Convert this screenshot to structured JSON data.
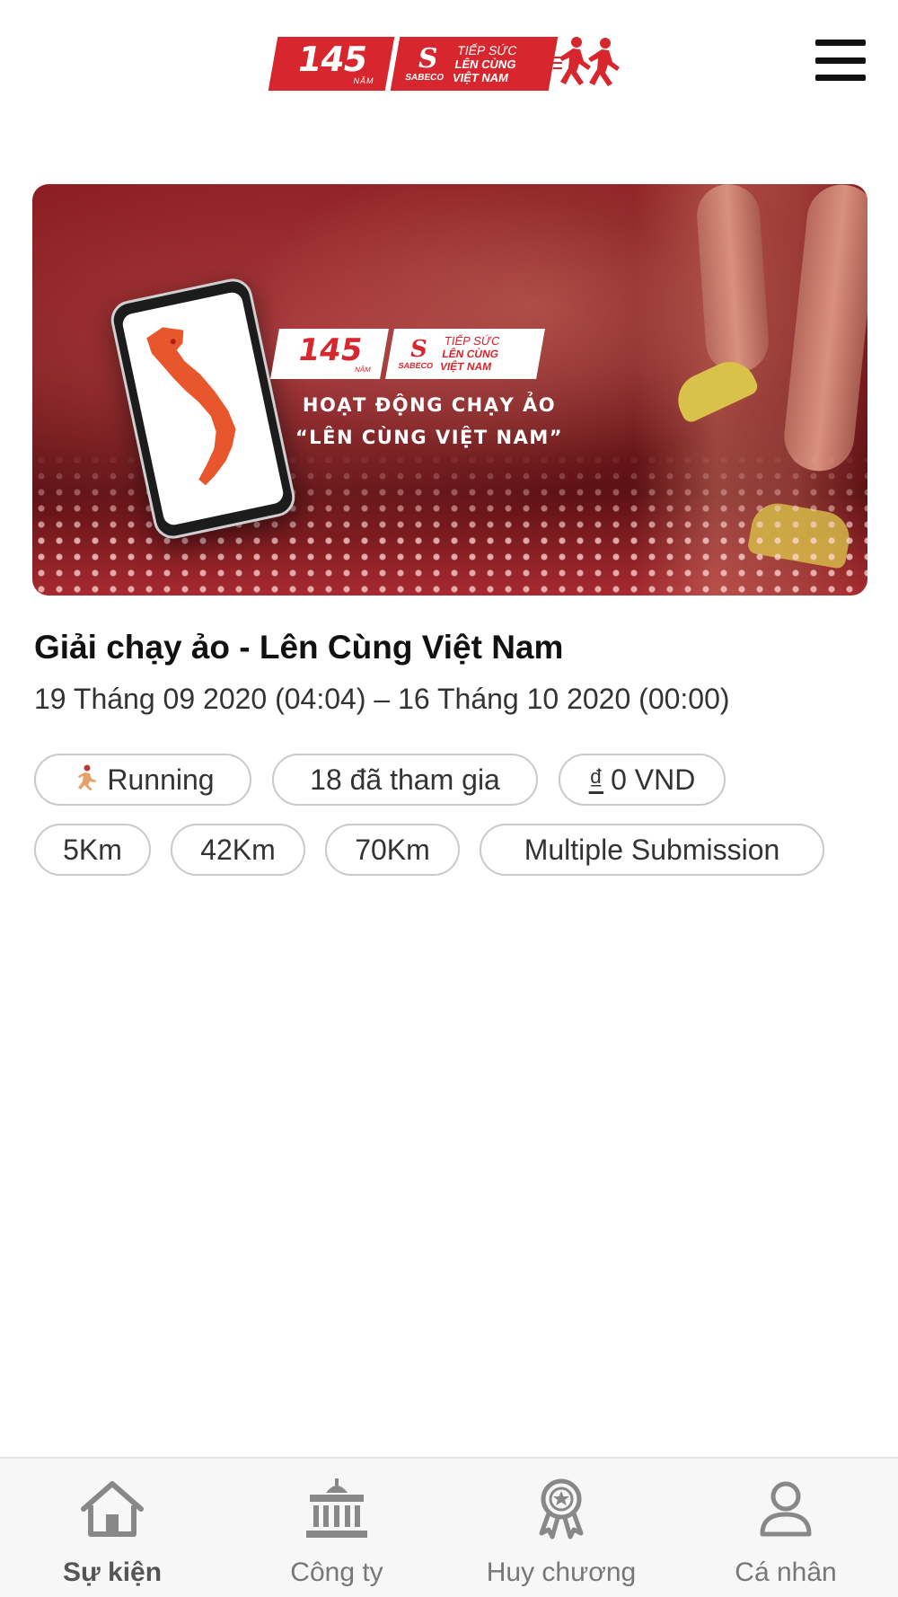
{
  "header": {
    "logo": {
      "anniversary_number": "145",
      "anniversary_word": "NĂM",
      "brand": "SABECO",
      "tagline_1": "TIẾP SỨC",
      "tagline_2": "LÊN CÙNG",
      "tagline_3": "VIỆT NAM"
    },
    "menu_icon": "hamburger-menu-icon"
  },
  "banner": {
    "headline_1": "HOẠT ĐỘNG CHẠY ẢO",
    "headline_2": "“LÊN CÙNG VIỆT NAM”",
    "accent_color": "#d7262e"
  },
  "event": {
    "title": "Giải chạy ảo - Lên Cùng Việt Nam",
    "date_range": "19 Tháng 09 2020 (04:04) – 16 Tháng 10 2020 (00:00)",
    "chips_row1": [
      {
        "icon": "runner-icon",
        "label": "Running"
      },
      {
        "label": "18 đã tham gia"
      },
      {
        "icon_text": "₫",
        "label": "0 VND"
      }
    ],
    "chips_row2": [
      {
        "label": "5Km"
      },
      {
        "label": "42Km"
      },
      {
        "label": "70Km"
      },
      {
        "label": "Multiple Submission"
      }
    ]
  },
  "bottom_nav": {
    "items": [
      {
        "icon": "home-icon",
        "label": "Sự kiện",
        "active": true
      },
      {
        "icon": "building-icon",
        "label": "Công ty",
        "active": false
      },
      {
        "icon": "medal-icon",
        "label": "Huy chương",
        "active": false
      },
      {
        "icon": "user-icon",
        "label": "Cá nhân",
        "active": false
      }
    ]
  }
}
